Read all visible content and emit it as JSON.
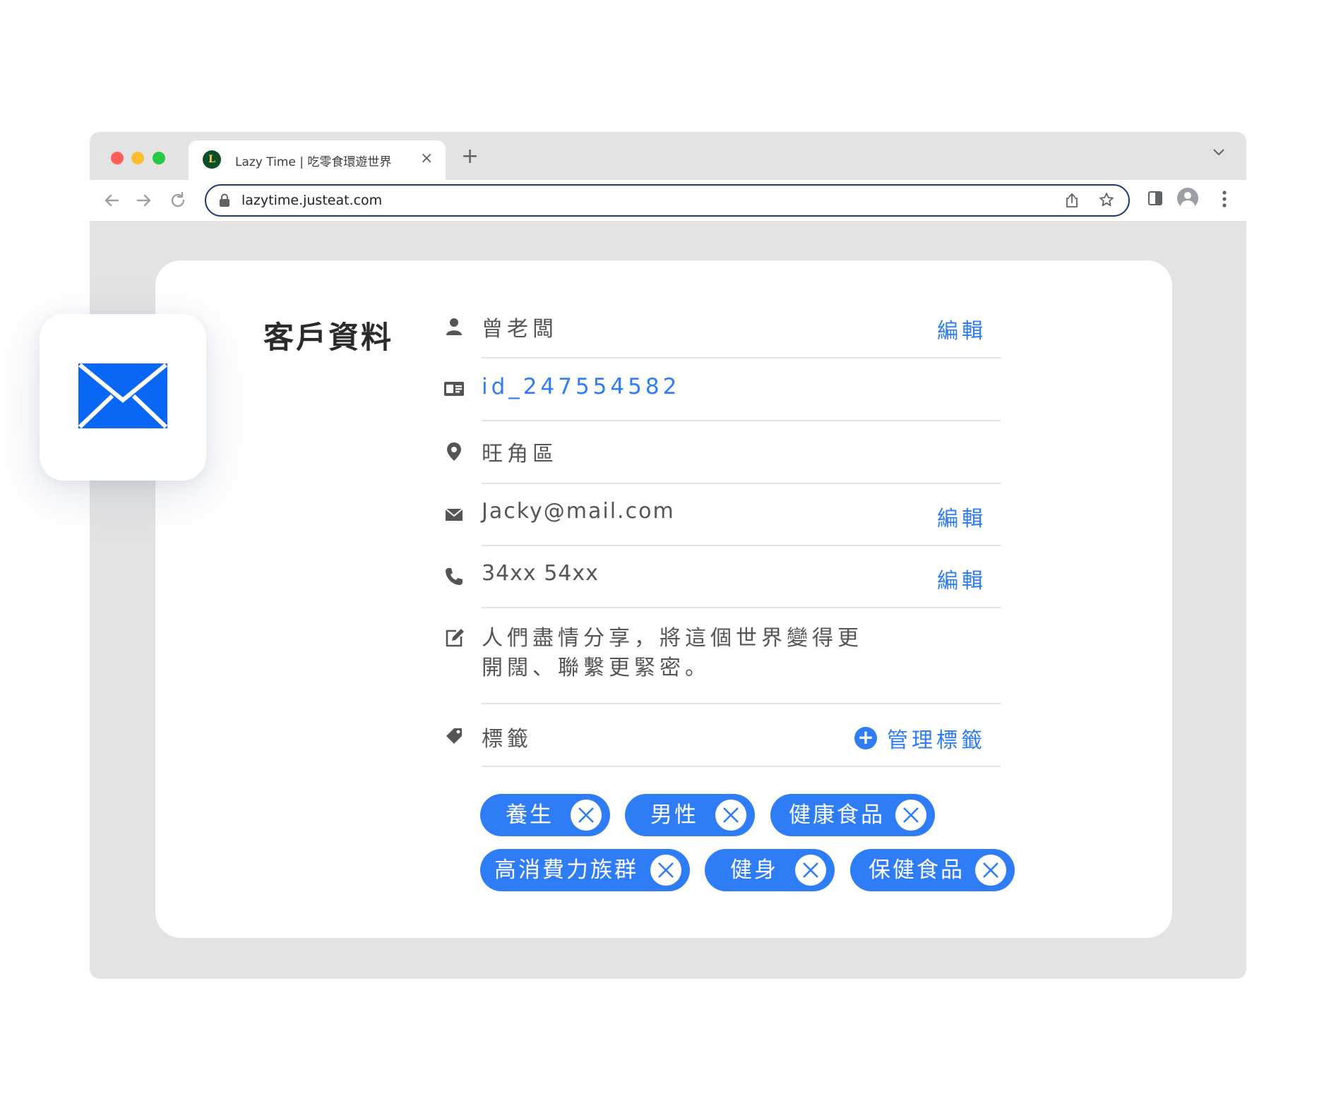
{
  "browser": {
    "tab_title": "Lazy Time | 吃零食環遊世界",
    "tab_favicon_letter": "L",
    "url": "lazytime.justeat.com",
    "traffic_colors": [
      "#ff5f57",
      "#febc2e",
      "#28c840"
    ]
  },
  "page": {
    "title": "客戶資料",
    "name": "曾老闆",
    "customer_id": "id_247554582",
    "district": "旺角區",
    "email": "Jacky@mail.com",
    "phone": "34xx 54xx",
    "bio_line1": "人們盡情分享，將這個世界變得更",
    "bio_line2": "開闊、聯繫更緊密。",
    "tags_label": "標籤",
    "manage_tags": "管理標籤",
    "edit_label": "編輯",
    "tags": [
      "養生",
      "男性",
      "健康食品",
      "高消費力族群",
      "健身",
      "保健食品"
    ],
    "accent_color": "#2f7df6"
  },
  "floating_card": {
    "icon": "mail-icon",
    "color": "#0a66f5"
  }
}
